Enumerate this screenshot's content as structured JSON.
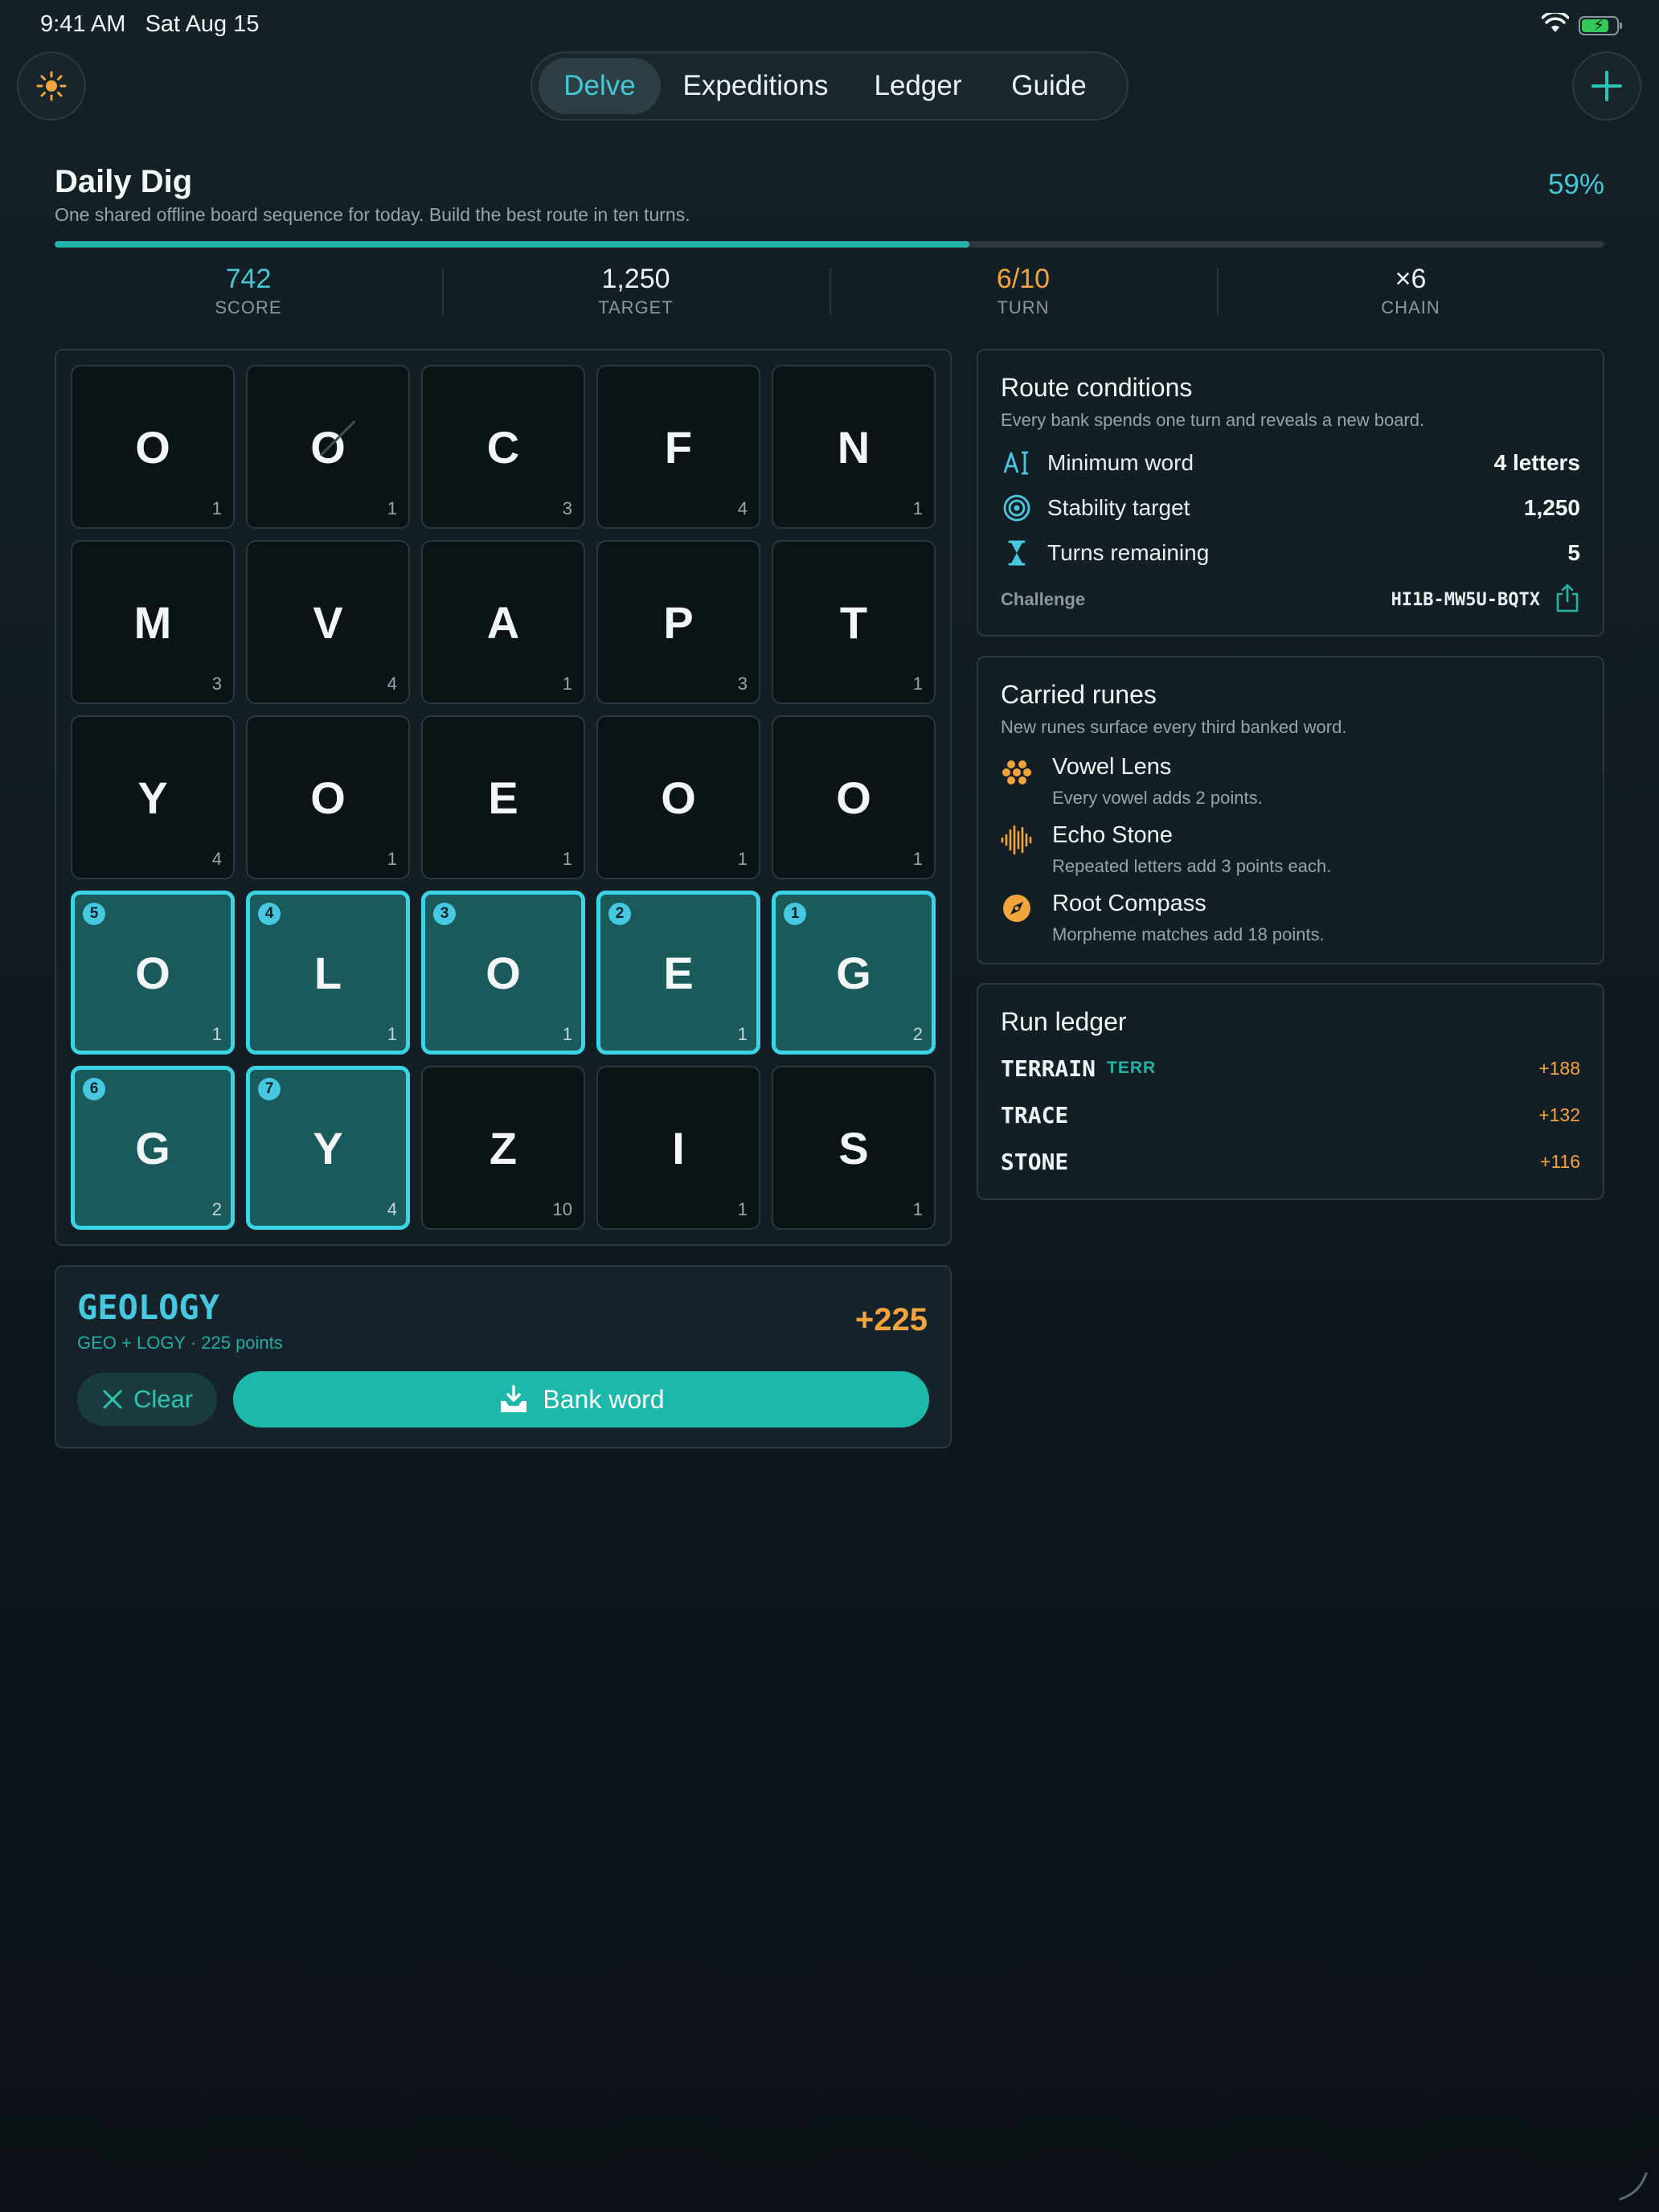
{
  "status_bar": {
    "time": "9:41 AM",
    "date": "Sat Aug 15",
    "icons": [
      "wifi-icon",
      "battery-charging-icon"
    ],
    "battery_level": 0.8
  },
  "nav": {
    "theme_icon": "sun-icon",
    "add_icon": "plus-icon",
    "tabs": [
      {
        "label": "Delve",
        "active": true
      },
      {
        "label": "Expeditions",
        "active": false
      },
      {
        "label": "Ledger",
        "active": false
      },
      {
        "label": "Guide",
        "active": false
      }
    ]
  },
  "header": {
    "title": "Daily Dig",
    "subtitle": "One shared offline board sequence for today. Build the best route in ten turns.",
    "progress_label": "59%",
    "progress": 0.59
  },
  "stats": [
    {
      "value": "742",
      "label": "SCORE",
      "color": "#45c8d6"
    },
    {
      "value": "1,250",
      "label": "TARGET",
      "color": "#eef3f5"
    },
    {
      "value": "6/10",
      "label": "TURN",
      "color": "#f3a43c"
    },
    {
      "value": "×6",
      "label": "CHAIN",
      "color": "#eef3f5"
    }
  ],
  "board": {
    "rows": [
      [
        {
          "letter": "O",
          "points": "1"
        },
        {
          "letter": "O",
          "points": "1",
          "struck": true
        },
        {
          "letter": "C",
          "points": "3"
        },
        {
          "letter": "F",
          "points": "4"
        },
        {
          "letter": "N",
          "points": "1"
        }
      ],
      [
        {
          "letter": "M",
          "points": "3"
        },
        {
          "letter": "V",
          "points": "4"
        },
        {
          "letter": "A",
          "points": "1"
        },
        {
          "letter": "P",
          "points": "3"
        },
        {
          "letter": "T",
          "points": "1"
        }
      ],
      [
        {
          "letter": "Y",
          "points": "4"
        },
        {
          "letter": "O",
          "points": "1"
        },
        {
          "letter": "E",
          "points": "1"
        },
        {
          "letter": "O",
          "points": "1"
        },
        {
          "letter": "O",
          "points": "1"
        }
      ],
      [
        {
          "letter": "O",
          "points": "1",
          "order": "5"
        },
        {
          "letter": "L",
          "points": "1",
          "order": "4"
        },
        {
          "letter": "O",
          "points": "1",
          "order": "3"
        },
        {
          "letter": "E",
          "points": "1",
          "order": "2"
        },
        {
          "letter": "G",
          "points": "2",
          "order": "1"
        }
      ],
      [
        {
          "letter": "G",
          "points": "2",
          "order": "6"
        },
        {
          "letter": "Y",
          "points": "4",
          "order": "7"
        },
        {
          "letter": "Z",
          "points": "10"
        },
        {
          "letter": "I",
          "points": "1"
        },
        {
          "letter": "S",
          "points": "1"
        }
      ]
    ]
  },
  "word_panel": {
    "word": "GEOLOGY",
    "detail": "GEO + LOGY · 225 points",
    "points": "+225",
    "clear_label": "Clear",
    "bank_label": "Bank word",
    "clear_icon": "x-icon",
    "bank_icon": "tray-download-icon"
  },
  "route_conditions": {
    "title": "Route conditions",
    "subtitle": "Every bank spends one turn and reveals a new board.",
    "rows": [
      {
        "icon": "text-cursor-icon",
        "label": "Minimum word",
        "value": "4 letters"
      },
      {
        "icon": "target-icon",
        "label": "Stability target",
        "value": "1,250"
      },
      {
        "icon": "hourglass-icon",
        "label": "Turns remaining",
        "value": "5"
      }
    ],
    "challenge_label": "Challenge",
    "challenge_code": "HI1B-MW5U-BQTX",
    "share_icon": "share-icon"
  },
  "carried_runes": {
    "title": "Carried runes",
    "subtitle": "New runes surface every third banked word.",
    "runes": [
      {
        "icon": "lens-dots-icon",
        "name": "Vowel Lens",
        "desc": "Every vowel adds 2 points."
      },
      {
        "icon": "waveform-icon",
        "name": "Echo Stone",
        "desc": "Repeated letters add 3 points each."
      },
      {
        "icon": "compass-icon",
        "name": "Root Compass",
        "desc": "Morpheme matches add 18 points."
      }
    ]
  },
  "run_ledger": {
    "title": "Run ledger",
    "rows": [
      {
        "word": "TERRAIN",
        "tag": "TERR",
        "points": "+188"
      },
      {
        "word": "TRACE",
        "tag": "",
        "points": "+132"
      },
      {
        "word": "STONE",
        "tag": "",
        "points": "+116"
      }
    ]
  },
  "colors": {
    "accent_cyan": "#45c8d6",
    "accent_teal": "#1bb8ab",
    "accent_orange": "#f3a43c",
    "selected_tile": "#1b5a5a",
    "background": "#111b21"
  }
}
